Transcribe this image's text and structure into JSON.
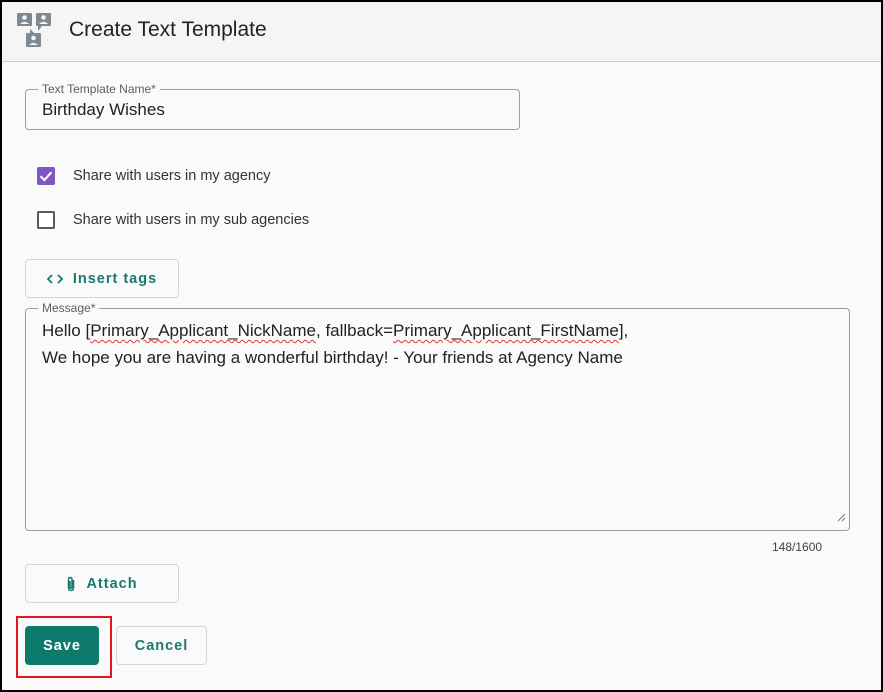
{
  "header": {
    "title": "Create Text Template",
    "icon": "contacts-chat-icon"
  },
  "form": {
    "template_name": {
      "label": "Text Template Name*",
      "value": "Birthday Wishes"
    },
    "share_agency": {
      "label": "Share with users in my agency",
      "checked": true
    },
    "share_sub_agencies": {
      "label": "Share with users in my sub agencies",
      "checked": false
    },
    "insert_tags_label": "Insert tags",
    "message": {
      "label": "Message*",
      "line1_prefix": "Hello [",
      "line1_tag1": "Primary_Applicant_NickName",
      "line1_mid": ", fallback=",
      "line1_tag2": "Primary_Applicant_FirstName",
      "line1_suffix": "],",
      "line2": "We hope you are having a wonderful birthday! - Your friends at Agency Name"
    },
    "counter": "148/1600",
    "attach_label": "Attach"
  },
  "actions": {
    "save_label": "Save",
    "cancel_label": "Cancel"
  },
  "colors": {
    "accent": "#0e7a6b",
    "checkbox": "#7e57c2",
    "highlight": "#e0171f"
  }
}
